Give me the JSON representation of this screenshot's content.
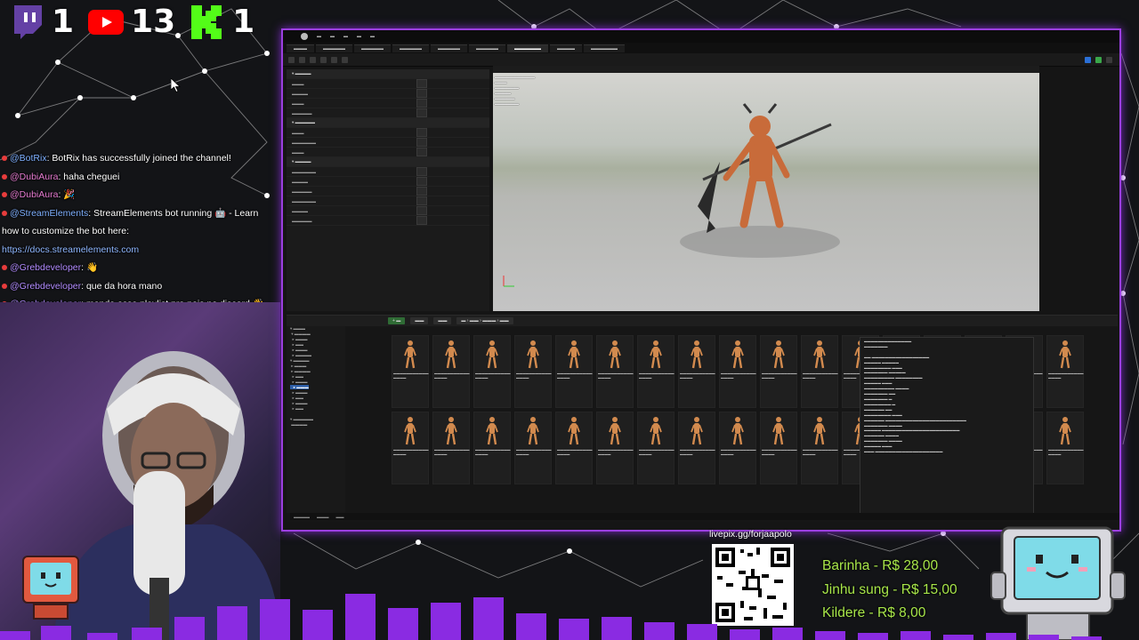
{
  "counters": [
    {
      "platform": "twitch",
      "icon": "twitch-icon",
      "value": "1"
    },
    {
      "platform": "youtube",
      "icon": "youtube-icon",
      "value": "13"
    },
    {
      "platform": "kick",
      "icon": "kick-icon",
      "value": "1"
    }
  ],
  "chat": [
    {
      "user": "@BotRix",
      "text": ": BotRix has successfully joined the channel!",
      "color": "#7fb0ff"
    },
    {
      "user": "@DubiAura",
      "text": ": haha cheguei",
      "color": "#e57bd0"
    },
    {
      "user": "@DubiAura",
      "text": ": 🎉",
      "color": "#e57bd0"
    },
    {
      "user": "@StreamElements",
      "text": ": StreamElements bot running 🤖 - Learn how to customize the bot here: ",
      "link": "https://docs.streamelements.com",
      "color": "#7fb0ff"
    },
    {
      "user": "@Grebdeveloper",
      "text": ": 👋",
      "color": "#b28cff"
    },
    {
      "user": "@Grebdeveloper",
      "text": ": que da hora mano",
      "color": "#b28cff"
    },
    {
      "user": "@Grebdeveloper",
      "text": ": manda essa playlist pra nois no discord 👋",
      "color": "#b28cff"
    }
  ],
  "qr": {
    "label": "livepix.gg/forjaapolo"
  },
  "donations": [
    {
      "text": "Barinha - R$ 28,00"
    },
    {
      "text": "Jinhu sung - R$ 15,00"
    },
    {
      "text": "Kildere - R$ 8,00"
    }
  ],
  "colors": {
    "accent": "#9c3fe0",
    "donation": "#a8e64a",
    "chat_dot": "#e83c3c"
  }
}
